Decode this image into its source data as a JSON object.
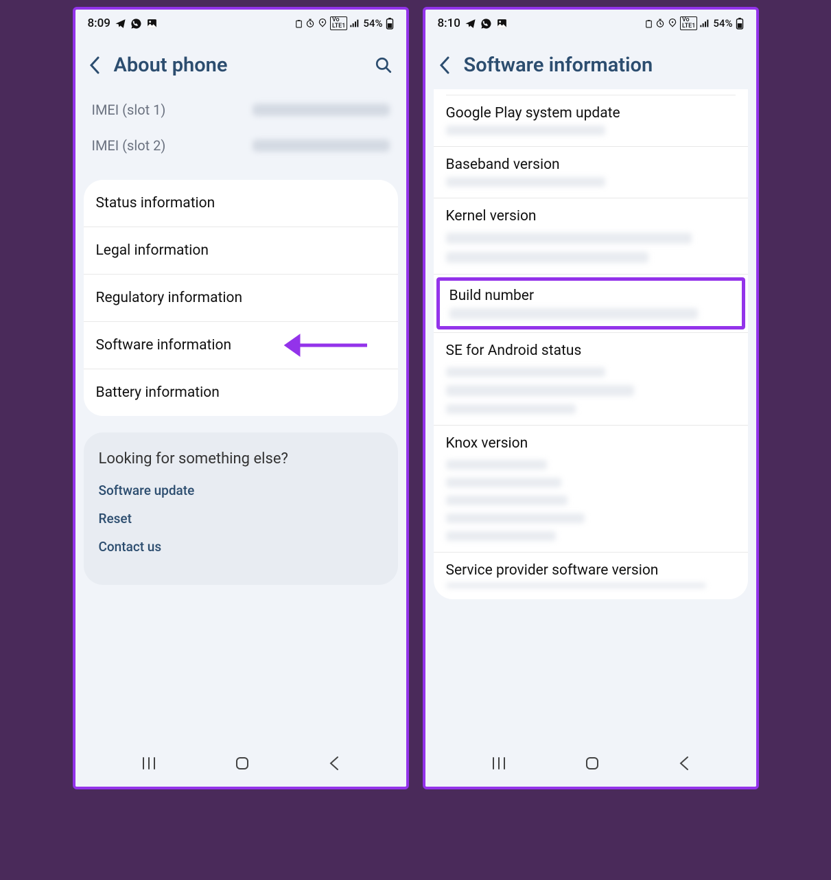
{
  "left": {
    "status_time": "8:09",
    "battery_text": "54%",
    "header_title": "About phone",
    "imei1_label": "IMEI (slot 1)",
    "imei2_label": "IMEI (slot 2)",
    "items": {
      "status": "Status information",
      "legal": "Legal information",
      "regulatory": "Regulatory information",
      "software": "Software information",
      "battery": "Battery information"
    },
    "footer": {
      "title": "Looking for something else?",
      "software_update": "Software update",
      "reset": "Reset",
      "contact": "Contact us"
    }
  },
  "right": {
    "status_time": "8:10",
    "battery_text": "54%",
    "header_title": "Software information",
    "items": {
      "play_update": "Google Play system update",
      "baseband": "Baseband version",
      "kernel": "Kernel version",
      "build": "Build number",
      "se_android": "SE for Android status",
      "knox": "Knox version",
      "service_provider": "Service provider software version"
    }
  }
}
